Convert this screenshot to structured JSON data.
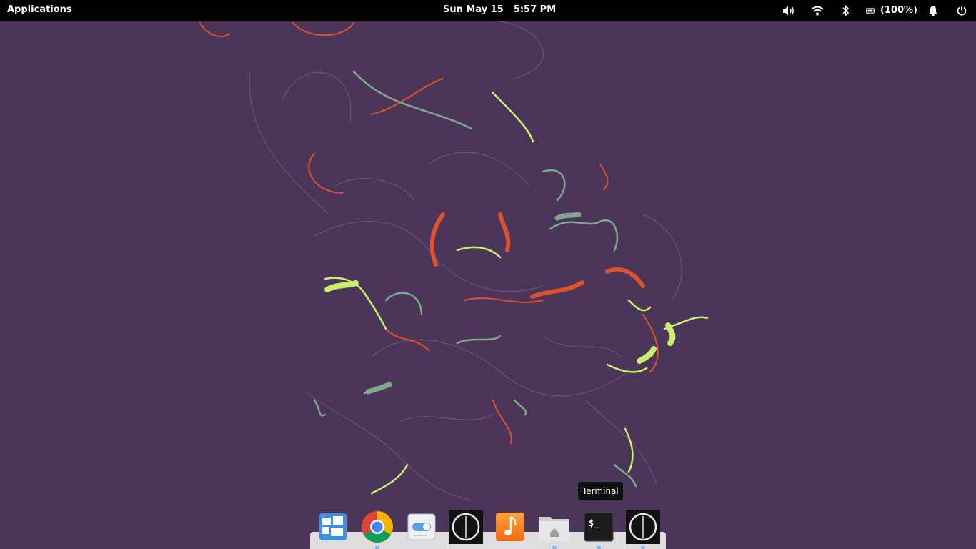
{
  "topbar": {
    "applications_label": "Applications",
    "date": "Sun May 15",
    "time": "5:57 PM",
    "battery_percent": "(100%)",
    "indicators": [
      "volume-icon",
      "wifi-icon",
      "bluetooth-icon",
      "battery-icon",
      "notifications-icon",
      "power-icon"
    ]
  },
  "dock": {
    "tooltip": "Terminal",
    "items": [
      {
        "name": "Multitasking View",
        "icon": "multitasking-view-icon",
        "running": false
      },
      {
        "name": "Google Chrome",
        "icon": "chrome-icon",
        "running": true
      },
      {
        "name": "System Settings",
        "icon": "system-settings-icon",
        "running": false
      },
      {
        "name": "Screen Clock",
        "icon": "clock-icon",
        "running": false
      },
      {
        "name": "Music",
        "icon": "music-icon",
        "running": false
      },
      {
        "name": "Files",
        "icon": "files-icon",
        "running": true
      },
      {
        "name": "Terminal",
        "icon": "terminal-icon",
        "running": true
      },
      {
        "name": "Screen Clock",
        "icon": "clock-icon",
        "running": true
      }
    ]
  },
  "colors": {
    "desktop_background": "#4b3659",
    "panel": "#000000",
    "strand_orange": "#e0502e",
    "strand_lime": "#c8f06e",
    "strand_sage": "#7fa98a",
    "running_dot": "#7fb7ea"
  }
}
